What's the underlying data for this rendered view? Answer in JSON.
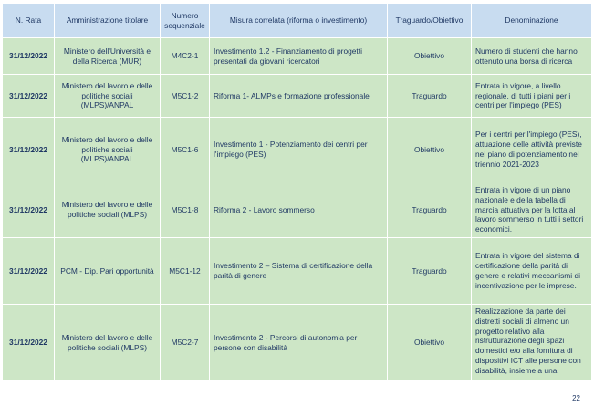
{
  "table": {
    "headers": {
      "rata": "N. Rata",
      "amministrazione": "Amministrazione titolare",
      "numero": "Numero sequenziale",
      "misura": "Misura correlata (riforma o investimento)",
      "traguardo": "Traguardo/Obiettivo",
      "denominazione": "Denominazione"
    },
    "rows": [
      {
        "rata": "31/12/2022",
        "amministrazione": "Ministero dell'Università e della Ricerca (MUR)",
        "numero": "M4C2-1",
        "misura": "Investimento 1.2 - Finanziamento di progetti presentati da giovani ricercatori",
        "traguardo": "Obiettivo",
        "denominazione": "Numero di studenti che hanno ottenuto una borsa di ricerca"
      },
      {
        "rata": "31/12/2022",
        "amministrazione": "Ministero del lavoro e delle politiche sociali (MLPS)/ANPAL",
        "numero": "M5C1-2",
        "misura": "Riforma 1- ALMPs e formazione professionale",
        "traguardo": "Traguardo",
        "denominazione": "Entrata in vigore, a livello regionale, di tutti i piani per i centri per l'impiego (PES)"
      },
      {
        "rata": "31/12/2022",
        "amministrazione": "Ministero del lavoro e delle politiche sociali (MLPS)/ANPAL",
        "numero": "M5C1-6",
        "misura": "Investimento 1 - Potenziamento dei centri per l'impiego (PES)",
        "traguardo": "Obiettivo",
        "denominazione": "Per i centri per l'impiego (PES), attuazione delle attività previste nel piano di potenziamento nel triennio 2021-2023"
      },
      {
        "rata": "31/12/2022",
        "amministrazione": "Ministero del lavoro e delle politiche sociali (MLPS)",
        "numero": "M5C1-8",
        "misura": "Riforma 2 - Lavoro sommerso",
        "traguardo": "Traguardo",
        "denominazione": "Entrata in vigore di un piano nazionale e della tabella di marcia attuativa per la lotta al lavoro sommerso in tutti i settori economici."
      },
      {
        "rata": "31/12/2022",
        "amministrazione": "PCM - Dip. Pari opportunità",
        "numero": "M5C1-12",
        "misura": "Investimento 2 – Sistema di certificazione della parità di genere",
        "traguardo": "Traguardo",
        "denominazione": "Entrata in vigore del sistema di certificazione della parità di genere e relativi meccanismi di incentivazione per le imprese."
      },
      {
        "rata": "31/12/2022",
        "amministrazione": "Ministero del lavoro e delle politiche sociali (MLPS)",
        "numero": "M5C2-7",
        "misura": "Investimento 2 - Percorsi di autonomia per persone con disabilità",
        "traguardo": "Obiettivo",
        "denominazione": "Realizzazione da parte dei distretti sociali di almeno un progetto relativo alla ristrutturazione degli spazi domestici e/o alla fornitura di dispositivi ICT alle persone con disabilità, insieme a una"
      }
    ]
  },
  "page_number": "22"
}
